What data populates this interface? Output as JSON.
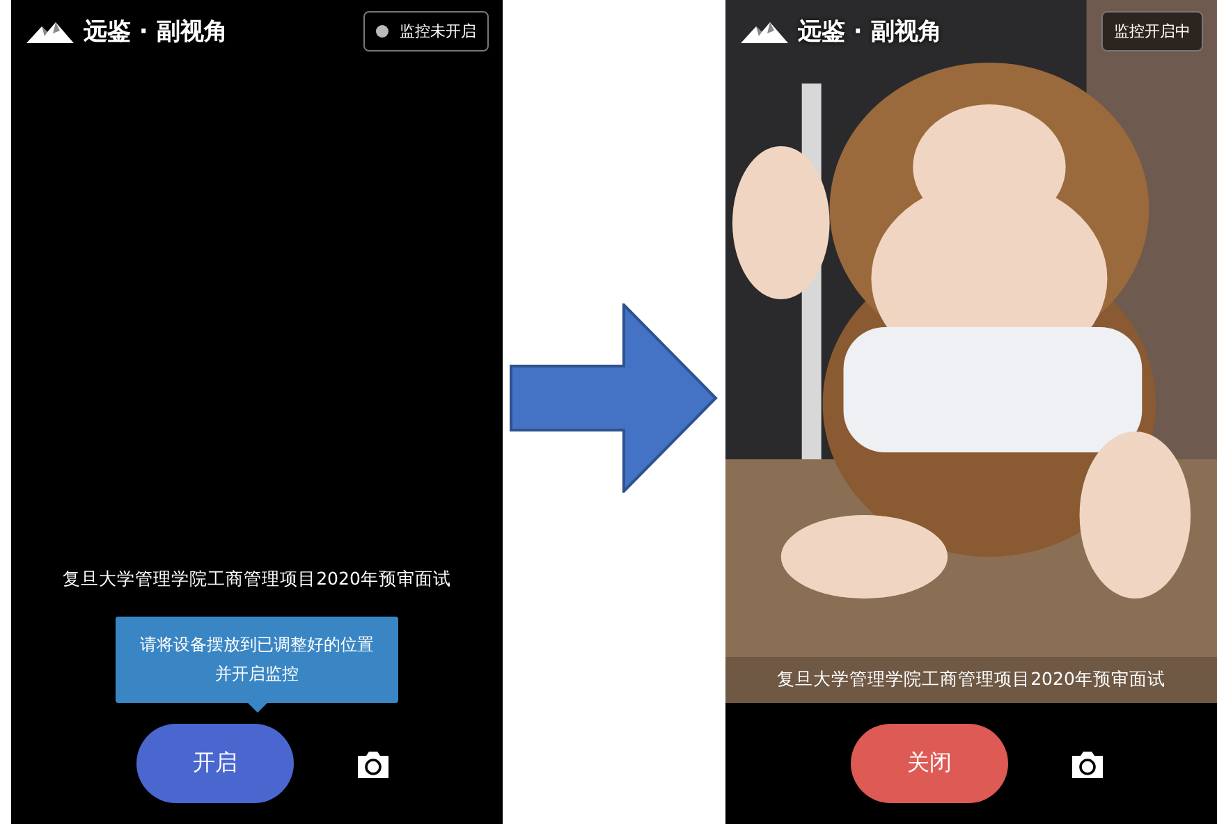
{
  "screens": [
    {
      "app_title": "远鉴 · 副视角",
      "status": "监控未开启",
      "monitoring": false,
      "subtitle": "复旦大学管理学院工商管理项目2020年预审面试",
      "tooltip": [
        "请将设备摆放到已调整好的位置",
        "并开启监控"
      ],
      "button": "开启"
    },
    {
      "app_title": "远鉴 · 副视角",
      "status": "监控开启中",
      "monitoring": true,
      "subtitle": "复旦大学管理学院工商管理项目2020年预审面试",
      "button": "关闭"
    }
  ]
}
